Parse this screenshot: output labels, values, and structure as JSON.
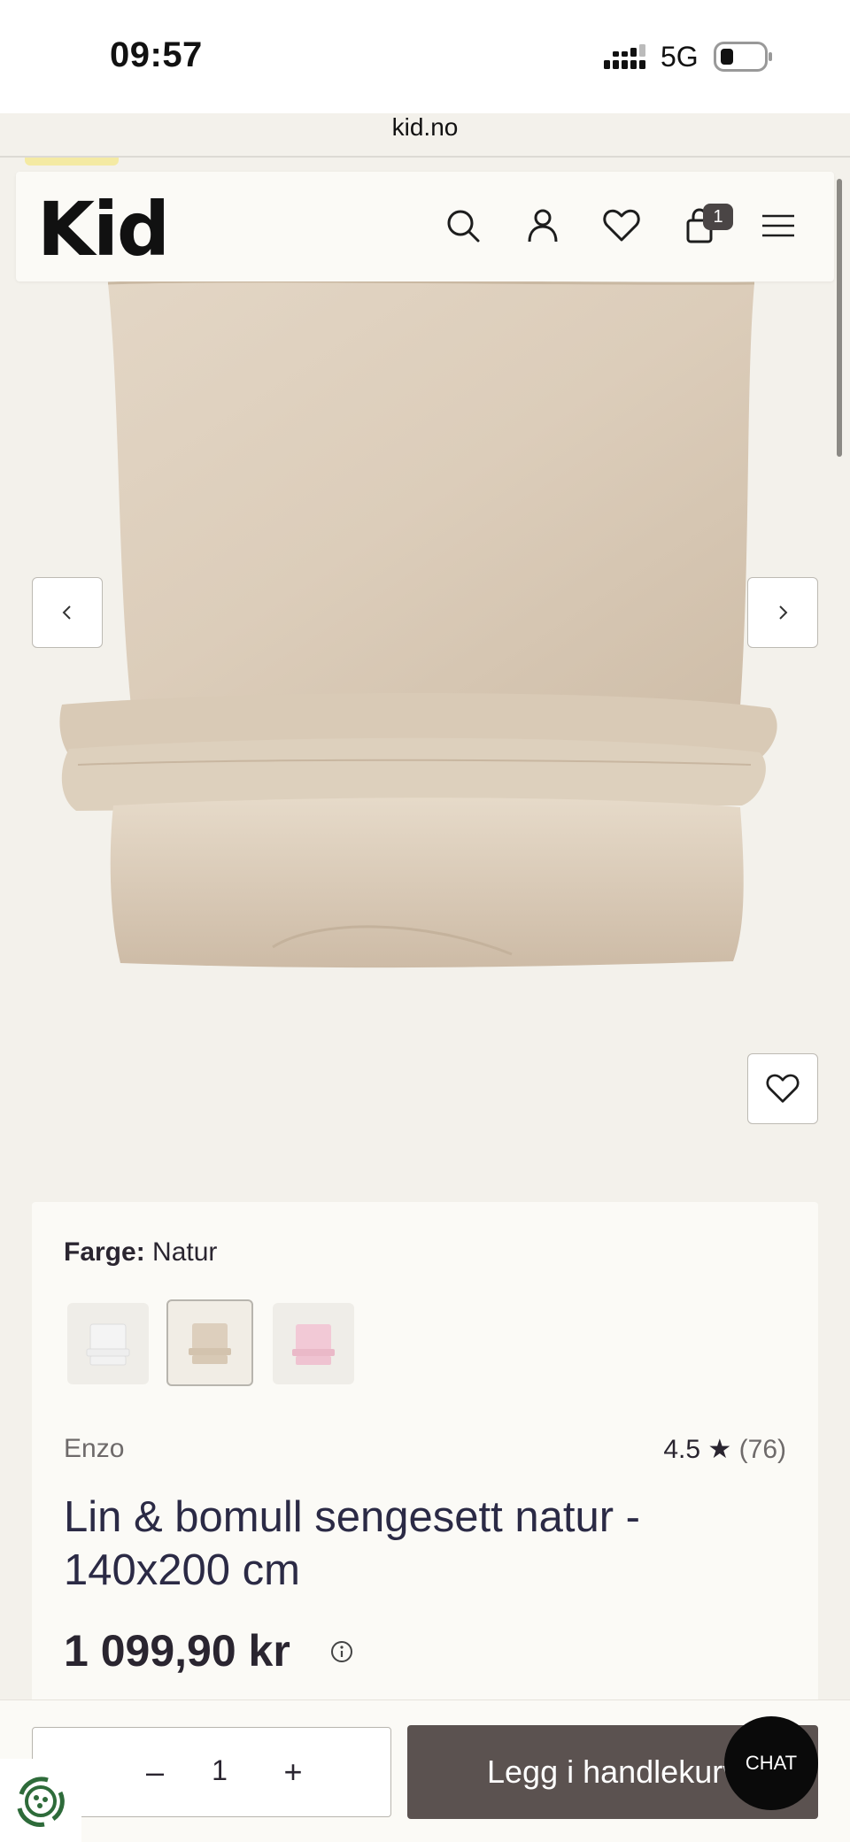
{
  "status_bar": {
    "time": "09:57",
    "network": "5G"
  },
  "browser": {
    "url": "kid.no"
  },
  "header": {
    "logo": "Kid",
    "cart_count": "1"
  },
  "product": {
    "color_label": "Farge:",
    "color_value": "Natur",
    "swatches": [
      "hvit",
      "natur",
      "rosa"
    ],
    "brand": "Enzo",
    "rating": "4.5",
    "rating_star": "★",
    "review_count": "(76)",
    "title": "Lin & bomull sengesett natur - 140x200 cm",
    "price": "1 099,90 kr"
  },
  "cart_bar": {
    "qty_minus": "–",
    "quantity": "1",
    "qty_plus": "+",
    "add_label": "Legg i handlekurv",
    "chat_label": "CHAT"
  },
  "colors": {
    "page_bg": "#f3f1eb",
    "card_bg": "#fbfaf6",
    "add_button": "#5b5250",
    "linen": "#ddcfbd"
  }
}
